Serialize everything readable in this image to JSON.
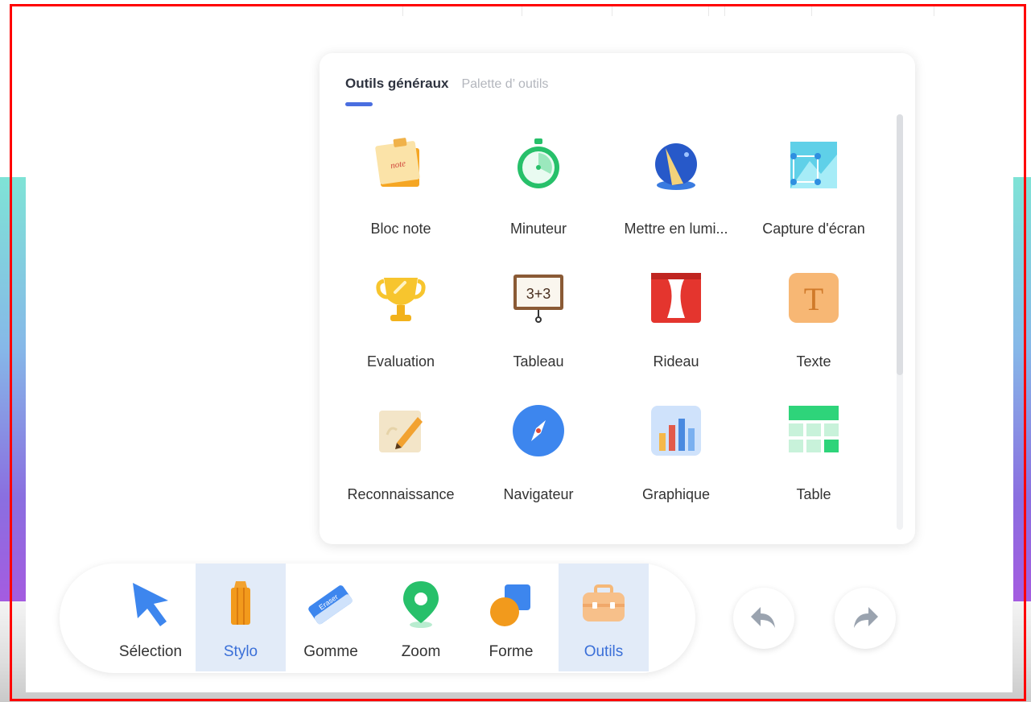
{
  "panel": {
    "tabs": [
      {
        "label": "Outils généraux",
        "active": true
      },
      {
        "label": "Palette d’  outils",
        "active": false
      }
    ],
    "tools": [
      {
        "label": "Bloc note",
        "icon": "note-icon"
      },
      {
        "label": "Minuteur",
        "icon": "stopwatch-icon"
      },
      {
        "label": "Mettre en lumi...",
        "icon": "spotlight-icon"
      },
      {
        "label": "Capture d'écran",
        "icon": "screenshot-icon"
      },
      {
        "label": "Evaluation",
        "icon": "trophy-icon"
      },
      {
        "label": "Tableau",
        "icon": "blackboard-icon"
      },
      {
        "label": "Rideau",
        "icon": "curtain-icon"
      },
      {
        "label": "Texte",
        "icon": "text-icon"
      },
      {
        "label": "Reconnaissance",
        "icon": "recognition-icon"
      },
      {
        "label": "Navigateur",
        "icon": "compass-icon"
      },
      {
        "label": "Graphique",
        "icon": "bar-chart-icon"
      },
      {
        "label": "Table",
        "icon": "table-icon"
      }
    ],
    "tableau_icon_text": "3+3",
    "texte_icon_letter": "T",
    "note_icon_text": "note"
  },
  "toolbar": {
    "items": [
      {
        "label": "Sélection",
        "icon": "cursor-arrow-icon",
        "selected": false
      },
      {
        "label": "Stylo",
        "icon": "pencil-icon",
        "selected": true
      },
      {
        "label": "Gomme",
        "icon": "eraser-icon",
        "selected": false
      },
      {
        "label": "Zoom",
        "icon": "map-pin-icon",
        "selected": false
      },
      {
        "label": "Forme",
        "icon": "shapes-icon",
        "selected": false
      },
      {
        "label": "Outils",
        "icon": "toolbox-icon",
        "selected": true
      }
    ],
    "eraser_icon_text": "Eraser"
  },
  "actions": {
    "undo_icon": "undo-icon",
    "redo_icon": "redo-icon"
  },
  "colors": {
    "accent": "#4a6ee0",
    "selected_bg": "#e2ebf8",
    "selected_text": "#3a6fd8",
    "frame": "#ff0000"
  }
}
